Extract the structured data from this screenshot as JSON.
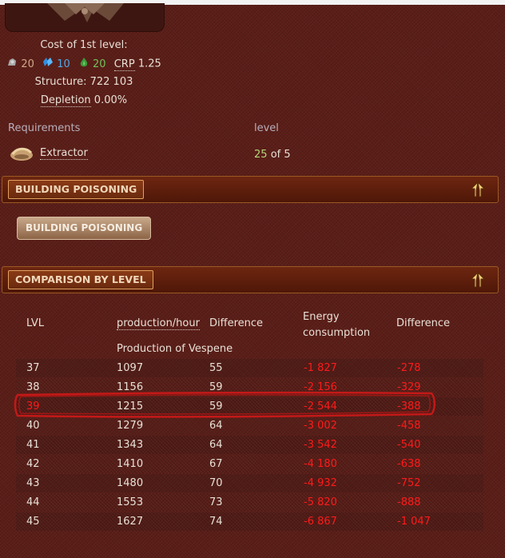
{
  "building": {
    "cost_title": "Cost of 1st level:",
    "cost": {
      "ore": "20",
      "crystal": "10",
      "gas": "20",
      "crp_label": "CRP",
      "crp_value": "1.25"
    },
    "structure_label": "Structure:",
    "structure_value": "722 103",
    "depletion_label": "Depletion",
    "depletion_value": "0.00%"
  },
  "requirements": {
    "header_name": "Requirements",
    "header_level": "level",
    "items": [
      {
        "name": "Extractor",
        "level_current": "25",
        "level_sep": "of",
        "level_required": "5"
      }
    ]
  },
  "sections": {
    "poisoning": {
      "title": "BUILDING POISONING",
      "button_label": "BUILDING POISONING"
    },
    "comparison": {
      "title": "COMPARISON BY LEVEL"
    }
  },
  "comparison_table": {
    "headers": [
      "LVL",
      "production/hour",
      "Difference",
      "Energy consumption",
      "Difference"
    ],
    "energy_header_line1": "Energy",
    "energy_header_line2": "consumption",
    "subheader": "Production of Vespene",
    "rows": [
      {
        "lvl": "37",
        "production": "1097",
        "diff": "55",
        "energy": "-1 827",
        "energy_diff": "-278"
      },
      {
        "lvl": "38",
        "production": "1156",
        "diff": "59",
        "energy": "-2 156",
        "energy_diff": "-329"
      },
      {
        "lvl": "39",
        "production": "1215",
        "diff": "59",
        "energy": "-2 544",
        "energy_diff": "-388"
      },
      {
        "lvl": "40",
        "production": "1279",
        "diff": "64",
        "energy": "-3 002",
        "energy_diff": "-458"
      },
      {
        "lvl": "41",
        "production": "1343",
        "diff": "64",
        "energy": "-3 542",
        "energy_diff": "-540"
      },
      {
        "lvl": "42",
        "production": "1410",
        "diff": "67",
        "energy": "-4 180",
        "energy_diff": "-638"
      },
      {
        "lvl": "43",
        "production": "1480",
        "diff": "70",
        "energy": "-4 932",
        "energy_diff": "-752"
      },
      {
        "lvl": "44",
        "production": "1553",
        "diff": "73",
        "energy": "-5 820",
        "energy_diff": "-888"
      },
      {
        "lvl": "45",
        "production": "1627",
        "diff": "74",
        "energy": "-6 867",
        "energy_diff": "-1 047"
      }
    ]
  },
  "icons": {
    "ore": "ore-icon",
    "crystal": "crystal-icon",
    "gas": "gas-icon",
    "extractor": "extractor-icon",
    "collapse": "collapse-icon"
  },
  "colors": {
    "background": "#5a1d17",
    "negative": "#ff1a1a",
    "level_current": "#b3d67a",
    "crystal": "#4fa8e8",
    "gas": "#6fc25a",
    "annotation": "#d01818"
  }
}
